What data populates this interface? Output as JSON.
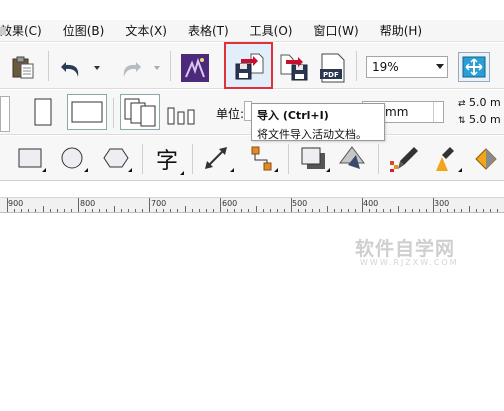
{
  "menu": {
    "items": [
      "效果(C)",
      "位图(B)",
      "文本(X)",
      "表格(T)",
      "工具(O)",
      "窗口(W)",
      "帮助(H)"
    ]
  },
  "toolbar": {
    "buttons": [
      "paste-icon",
      "undo-icon",
      "redo-icon",
      "corel-launcher-icon",
      "import-icon",
      "export-icon",
      "publish-pdf-icon",
      "full-screen-icon"
    ],
    "zoom_value": "19%"
  },
  "property_bar": {
    "unit_label": "单位:",
    "nudge_unit": "mm",
    "dup_x": "5.0 m",
    "dup_y": "5.0 m"
  },
  "tooltip": {
    "title": "导入 (Ctrl+I)",
    "description": "将文件导入活动文档。"
  },
  "toolbox": {
    "tools": [
      "rectangle-tool-icon",
      "ellipse-tool-icon",
      "polygon-tool-icon",
      "text-tool-icon",
      "dimension-tool-icon",
      "connector-tool-icon",
      "drop-shadow-tool-icon",
      "transparency-tool-icon",
      "color-eyedropper-icon",
      "fill-eyedropper-icon",
      "interactive-fill-icon",
      "smart-fill-icon"
    ],
    "text_tool_glyph": "字"
  },
  "ruler": {
    "labels": [
      "900",
      "800",
      "700",
      "600",
      "500",
      "400",
      "300"
    ]
  },
  "watermark": {
    "title": "软件自学网",
    "url": "WWW.RJZXW.COM"
  },
  "colors": {
    "highlight_border": "#e0303a",
    "export_arrow": "#c8102e",
    "canvas_background": "#ffffff"
  }
}
